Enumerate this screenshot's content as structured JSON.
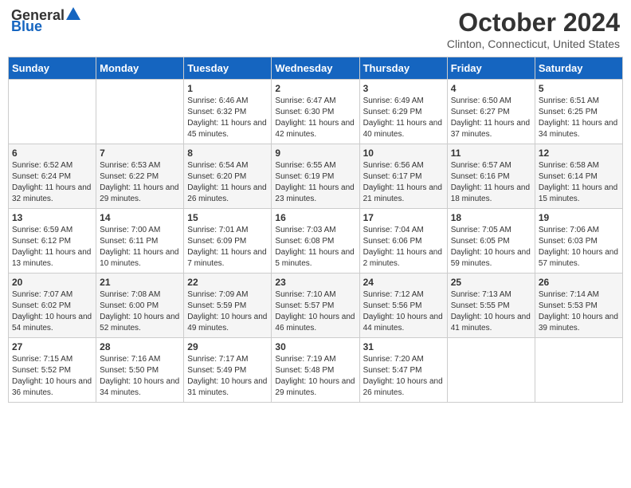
{
  "logo": {
    "general": "General",
    "blue": "Blue"
  },
  "title": "October 2024",
  "subtitle": "Clinton, Connecticut, United States",
  "days_of_week": [
    "Sunday",
    "Monday",
    "Tuesday",
    "Wednesday",
    "Thursday",
    "Friday",
    "Saturday"
  ],
  "weeks": [
    [
      {
        "day": "",
        "info": ""
      },
      {
        "day": "",
        "info": ""
      },
      {
        "day": "1",
        "info": "Sunrise: 6:46 AM\nSunset: 6:32 PM\nDaylight: 11 hours and 45 minutes."
      },
      {
        "day": "2",
        "info": "Sunrise: 6:47 AM\nSunset: 6:30 PM\nDaylight: 11 hours and 42 minutes."
      },
      {
        "day": "3",
        "info": "Sunrise: 6:49 AM\nSunset: 6:29 PM\nDaylight: 11 hours and 40 minutes."
      },
      {
        "day": "4",
        "info": "Sunrise: 6:50 AM\nSunset: 6:27 PM\nDaylight: 11 hours and 37 minutes."
      },
      {
        "day": "5",
        "info": "Sunrise: 6:51 AM\nSunset: 6:25 PM\nDaylight: 11 hours and 34 minutes."
      }
    ],
    [
      {
        "day": "6",
        "info": "Sunrise: 6:52 AM\nSunset: 6:24 PM\nDaylight: 11 hours and 32 minutes."
      },
      {
        "day": "7",
        "info": "Sunrise: 6:53 AM\nSunset: 6:22 PM\nDaylight: 11 hours and 29 minutes."
      },
      {
        "day": "8",
        "info": "Sunrise: 6:54 AM\nSunset: 6:20 PM\nDaylight: 11 hours and 26 minutes."
      },
      {
        "day": "9",
        "info": "Sunrise: 6:55 AM\nSunset: 6:19 PM\nDaylight: 11 hours and 23 minutes."
      },
      {
        "day": "10",
        "info": "Sunrise: 6:56 AM\nSunset: 6:17 PM\nDaylight: 11 hours and 21 minutes."
      },
      {
        "day": "11",
        "info": "Sunrise: 6:57 AM\nSunset: 6:16 PM\nDaylight: 11 hours and 18 minutes."
      },
      {
        "day": "12",
        "info": "Sunrise: 6:58 AM\nSunset: 6:14 PM\nDaylight: 11 hours and 15 minutes."
      }
    ],
    [
      {
        "day": "13",
        "info": "Sunrise: 6:59 AM\nSunset: 6:12 PM\nDaylight: 11 hours and 13 minutes."
      },
      {
        "day": "14",
        "info": "Sunrise: 7:00 AM\nSunset: 6:11 PM\nDaylight: 11 hours and 10 minutes."
      },
      {
        "day": "15",
        "info": "Sunrise: 7:01 AM\nSunset: 6:09 PM\nDaylight: 11 hours and 7 minutes."
      },
      {
        "day": "16",
        "info": "Sunrise: 7:03 AM\nSunset: 6:08 PM\nDaylight: 11 hours and 5 minutes."
      },
      {
        "day": "17",
        "info": "Sunrise: 7:04 AM\nSunset: 6:06 PM\nDaylight: 11 hours and 2 minutes."
      },
      {
        "day": "18",
        "info": "Sunrise: 7:05 AM\nSunset: 6:05 PM\nDaylight: 10 hours and 59 minutes."
      },
      {
        "day": "19",
        "info": "Sunrise: 7:06 AM\nSunset: 6:03 PM\nDaylight: 10 hours and 57 minutes."
      }
    ],
    [
      {
        "day": "20",
        "info": "Sunrise: 7:07 AM\nSunset: 6:02 PM\nDaylight: 10 hours and 54 minutes."
      },
      {
        "day": "21",
        "info": "Sunrise: 7:08 AM\nSunset: 6:00 PM\nDaylight: 10 hours and 52 minutes."
      },
      {
        "day": "22",
        "info": "Sunrise: 7:09 AM\nSunset: 5:59 PM\nDaylight: 10 hours and 49 minutes."
      },
      {
        "day": "23",
        "info": "Sunrise: 7:10 AM\nSunset: 5:57 PM\nDaylight: 10 hours and 46 minutes."
      },
      {
        "day": "24",
        "info": "Sunrise: 7:12 AM\nSunset: 5:56 PM\nDaylight: 10 hours and 44 minutes."
      },
      {
        "day": "25",
        "info": "Sunrise: 7:13 AM\nSunset: 5:55 PM\nDaylight: 10 hours and 41 minutes."
      },
      {
        "day": "26",
        "info": "Sunrise: 7:14 AM\nSunset: 5:53 PM\nDaylight: 10 hours and 39 minutes."
      }
    ],
    [
      {
        "day": "27",
        "info": "Sunrise: 7:15 AM\nSunset: 5:52 PM\nDaylight: 10 hours and 36 minutes."
      },
      {
        "day": "28",
        "info": "Sunrise: 7:16 AM\nSunset: 5:50 PM\nDaylight: 10 hours and 34 minutes."
      },
      {
        "day": "29",
        "info": "Sunrise: 7:17 AM\nSunset: 5:49 PM\nDaylight: 10 hours and 31 minutes."
      },
      {
        "day": "30",
        "info": "Sunrise: 7:19 AM\nSunset: 5:48 PM\nDaylight: 10 hours and 29 minutes."
      },
      {
        "day": "31",
        "info": "Sunrise: 7:20 AM\nSunset: 5:47 PM\nDaylight: 10 hours and 26 minutes."
      },
      {
        "day": "",
        "info": ""
      },
      {
        "day": "",
        "info": ""
      }
    ]
  ]
}
